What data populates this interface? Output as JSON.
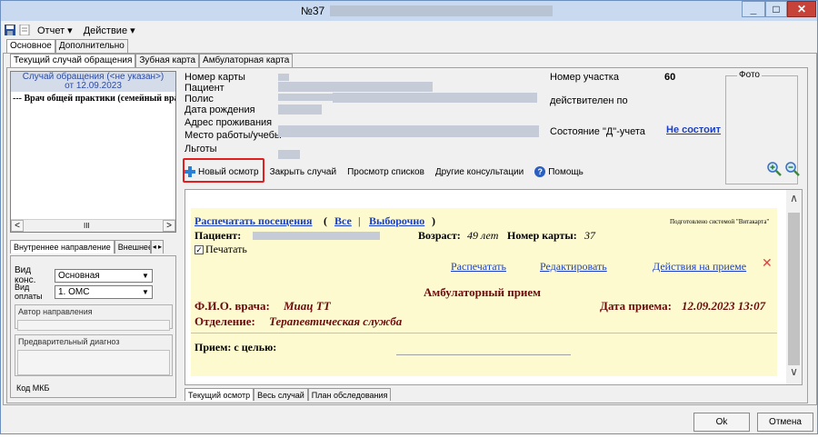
{
  "window": {
    "title": "№37"
  },
  "menu": {
    "items": [
      "Отчет ▾",
      "Действие ▾"
    ]
  },
  "top_tabs": [
    "Основное",
    "Дополнительно"
  ],
  "sub_tabs": [
    "Текущий случай обращения",
    "Зубная карта",
    "Амбулаторная карта"
  ],
  "case_panel": {
    "header_line1": "Случай обращения (<не указан>)",
    "header_line2": "от 12.09.2023",
    "row": "--- Врач общей практики (семейный врач",
    "scroll_left": "<",
    "scroll_right": ">",
    "scroll_thumb": "III"
  },
  "direction_tabs": [
    "Внутреннее направление",
    "Внешнее на"
  ],
  "direction_tab_arrows": "◂ ▸",
  "direction": {
    "vid_kons_label": "Вид конс.",
    "vid_kons_value": "Основная",
    "vid_oplaty_label": "Вид оплаты",
    "vid_oplaty_value": "1. ОМС",
    "author_label": "Автор направления",
    "prelim_label": "Предварительный диагноз",
    "mkb_label": "Код МКБ"
  },
  "patient_info": {
    "labels": [
      "Номер карты",
      "Пациент",
      "Полис",
      "Дата рождения",
      "Адрес проживания",
      "Место работы/учебы",
      "Льготы"
    ],
    "uchastok_label": "Номер участка",
    "uchastok_value": "60",
    "valid_label": "действителен по",
    "d_label": "Состояние \"Д\"-учета",
    "d_value": "Не состоит",
    "photo_label": "Фото"
  },
  "toolbar": {
    "new_exam": "Новый осмотр",
    "close_case": "Закрыть случай",
    "view_lists": "Просмотр списков",
    "other_consults": "Другие консультации",
    "help": "Помощь"
  },
  "document": {
    "print_visits": "Распечатать посещения",
    "open_paren": "(",
    "all": "Все",
    "sep": "|",
    "selective": "Выборочно",
    "close_paren": ")",
    "prepared_by": "Подготовлено системой \"Витакарта\"",
    "patient_label": "Пациент:",
    "age_label": "Возраст:",
    "age_value": "49 лет",
    "card_label": "Номер карты:",
    "card_value": "37",
    "print_checkbox": "Печатать",
    "action_print": "Распечатать",
    "action_edit": "Редактировать",
    "action_actions": "Действия на приеме",
    "close_x": "✕",
    "heading": "Амбулаторный прием",
    "doctor_label": "Ф.И.О. врача:",
    "doctor_value": "Миац ТТ",
    "date_label": "Дата приема:",
    "date_value": "12.09.2023 13:07",
    "dept_label": "Отделение:",
    "dept_value": "Терапевтическая служба",
    "goal_label": "Прием: с целью:"
  },
  "bottom_tabs": [
    "Текущий осмотр",
    "Весь случай",
    "План обследования"
  ],
  "buttons": {
    "ok": "Ok",
    "cancel": "Отмена"
  }
}
